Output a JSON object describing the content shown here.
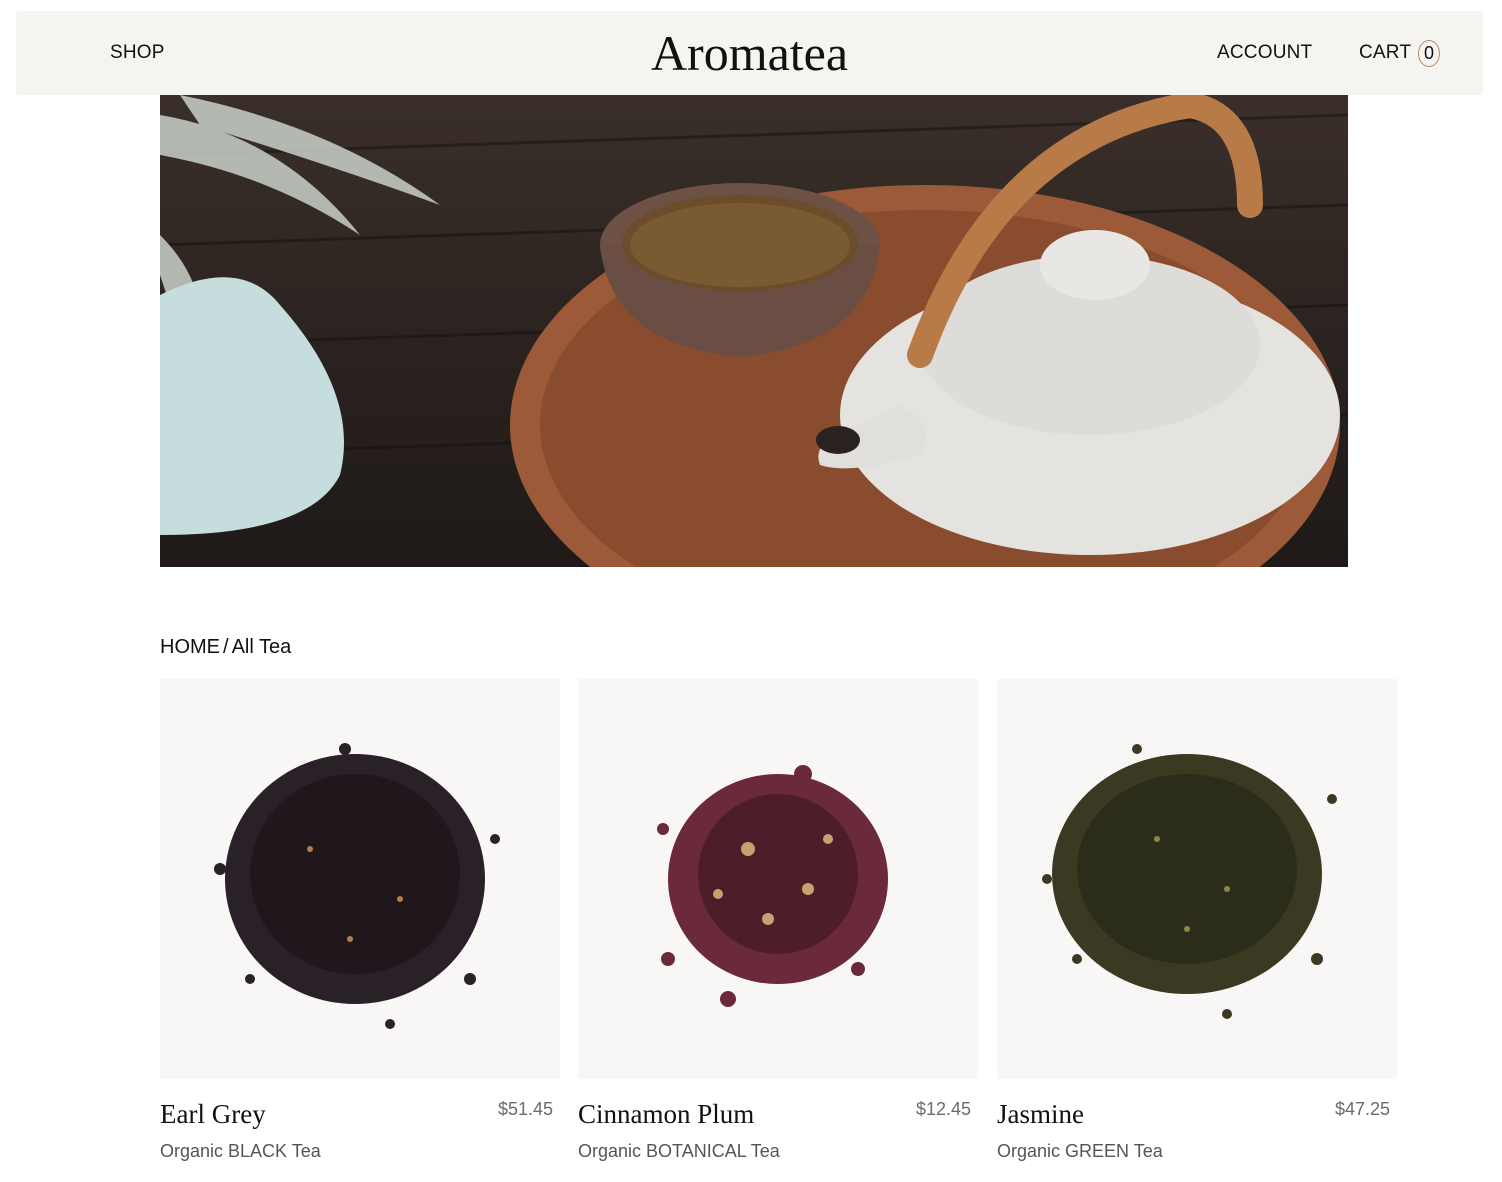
{
  "header": {
    "logo": "Aromatea",
    "shop_label": "SHOP",
    "account_label": "ACCOUNT",
    "cart_label": "CART",
    "cart_count": "0"
  },
  "breadcrumb": {
    "home": "HOME",
    "separator": "/",
    "current": "All Tea"
  },
  "products": [
    {
      "name": "Earl Grey",
      "price": "$51.45",
      "subtitle": "Organic BLACK Tea",
      "leaf_color": "#2a2028"
    },
    {
      "name": "Cinnamon Plum",
      "price": "$12.45",
      "subtitle": "Organic BOTANICAL Tea",
      "leaf_color": "#6b2a3a"
    },
    {
      "name": "Jasmine",
      "price": "$47.25",
      "subtitle": "Organic GREEN Tea",
      "leaf_color": "#3a3a22"
    }
  ],
  "colors": {
    "header_bg": "#f5f4f0",
    "product_bg": "#f8f7f5",
    "price_text": "#6b6b6b"
  }
}
